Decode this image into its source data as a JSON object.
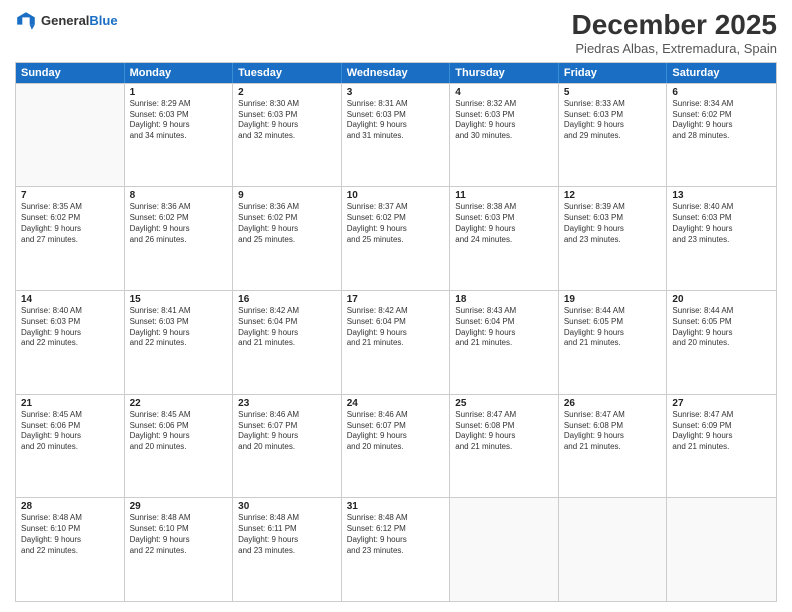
{
  "header": {
    "logo_general": "General",
    "logo_blue": "Blue",
    "title": "December 2025",
    "subtitle": "Piedras Albas, Extremadura, Spain"
  },
  "days_of_week": [
    "Sunday",
    "Monday",
    "Tuesday",
    "Wednesday",
    "Thursday",
    "Friday",
    "Saturday"
  ],
  "weeks": [
    [
      {
        "day": "",
        "lines": []
      },
      {
        "day": "1",
        "lines": [
          "Sunrise: 8:29 AM",
          "Sunset: 6:03 PM",
          "Daylight: 9 hours",
          "and 34 minutes."
        ]
      },
      {
        "day": "2",
        "lines": [
          "Sunrise: 8:30 AM",
          "Sunset: 6:03 PM",
          "Daylight: 9 hours",
          "and 32 minutes."
        ]
      },
      {
        "day": "3",
        "lines": [
          "Sunrise: 8:31 AM",
          "Sunset: 6:03 PM",
          "Daylight: 9 hours",
          "and 31 minutes."
        ]
      },
      {
        "day": "4",
        "lines": [
          "Sunrise: 8:32 AM",
          "Sunset: 6:03 PM",
          "Daylight: 9 hours",
          "and 30 minutes."
        ]
      },
      {
        "day": "5",
        "lines": [
          "Sunrise: 8:33 AM",
          "Sunset: 6:03 PM",
          "Daylight: 9 hours",
          "and 29 minutes."
        ]
      },
      {
        "day": "6",
        "lines": [
          "Sunrise: 8:34 AM",
          "Sunset: 6:02 PM",
          "Daylight: 9 hours",
          "and 28 minutes."
        ]
      }
    ],
    [
      {
        "day": "7",
        "lines": [
          "Sunrise: 8:35 AM",
          "Sunset: 6:02 PM",
          "Daylight: 9 hours",
          "and 27 minutes."
        ]
      },
      {
        "day": "8",
        "lines": [
          "Sunrise: 8:36 AM",
          "Sunset: 6:02 PM",
          "Daylight: 9 hours",
          "and 26 minutes."
        ]
      },
      {
        "day": "9",
        "lines": [
          "Sunrise: 8:36 AM",
          "Sunset: 6:02 PM",
          "Daylight: 9 hours",
          "and 25 minutes."
        ]
      },
      {
        "day": "10",
        "lines": [
          "Sunrise: 8:37 AM",
          "Sunset: 6:02 PM",
          "Daylight: 9 hours",
          "and 25 minutes."
        ]
      },
      {
        "day": "11",
        "lines": [
          "Sunrise: 8:38 AM",
          "Sunset: 6:03 PM",
          "Daylight: 9 hours",
          "and 24 minutes."
        ]
      },
      {
        "day": "12",
        "lines": [
          "Sunrise: 8:39 AM",
          "Sunset: 6:03 PM",
          "Daylight: 9 hours",
          "and 23 minutes."
        ]
      },
      {
        "day": "13",
        "lines": [
          "Sunrise: 8:40 AM",
          "Sunset: 6:03 PM",
          "Daylight: 9 hours",
          "and 23 minutes."
        ]
      }
    ],
    [
      {
        "day": "14",
        "lines": [
          "Sunrise: 8:40 AM",
          "Sunset: 6:03 PM",
          "Daylight: 9 hours",
          "and 22 minutes."
        ]
      },
      {
        "day": "15",
        "lines": [
          "Sunrise: 8:41 AM",
          "Sunset: 6:03 PM",
          "Daylight: 9 hours",
          "and 22 minutes."
        ]
      },
      {
        "day": "16",
        "lines": [
          "Sunrise: 8:42 AM",
          "Sunset: 6:04 PM",
          "Daylight: 9 hours",
          "and 21 minutes."
        ]
      },
      {
        "day": "17",
        "lines": [
          "Sunrise: 8:42 AM",
          "Sunset: 6:04 PM",
          "Daylight: 9 hours",
          "and 21 minutes."
        ]
      },
      {
        "day": "18",
        "lines": [
          "Sunrise: 8:43 AM",
          "Sunset: 6:04 PM",
          "Daylight: 9 hours",
          "and 21 minutes."
        ]
      },
      {
        "day": "19",
        "lines": [
          "Sunrise: 8:44 AM",
          "Sunset: 6:05 PM",
          "Daylight: 9 hours",
          "and 21 minutes."
        ]
      },
      {
        "day": "20",
        "lines": [
          "Sunrise: 8:44 AM",
          "Sunset: 6:05 PM",
          "Daylight: 9 hours",
          "and 20 minutes."
        ]
      }
    ],
    [
      {
        "day": "21",
        "lines": [
          "Sunrise: 8:45 AM",
          "Sunset: 6:06 PM",
          "Daylight: 9 hours",
          "and 20 minutes."
        ]
      },
      {
        "day": "22",
        "lines": [
          "Sunrise: 8:45 AM",
          "Sunset: 6:06 PM",
          "Daylight: 9 hours",
          "and 20 minutes."
        ]
      },
      {
        "day": "23",
        "lines": [
          "Sunrise: 8:46 AM",
          "Sunset: 6:07 PM",
          "Daylight: 9 hours",
          "and 20 minutes."
        ]
      },
      {
        "day": "24",
        "lines": [
          "Sunrise: 8:46 AM",
          "Sunset: 6:07 PM",
          "Daylight: 9 hours",
          "and 20 minutes."
        ]
      },
      {
        "day": "25",
        "lines": [
          "Sunrise: 8:47 AM",
          "Sunset: 6:08 PM",
          "Daylight: 9 hours",
          "and 21 minutes."
        ]
      },
      {
        "day": "26",
        "lines": [
          "Sunrise: 8:47 AM",
          "Sunset: 6:08 PM",
          "Daylight: 9 hours",
          "and 21 minutes."
        ]
      },
      {
        "day": "27",
        "lines": [
          "Sunrise: 8:47 AM",
          "Sunset: 6:09 PM",
          "Daylight: 9 hours",
          "and 21 minutes."
        ]
      }
    ],
    [
      {
        "day": "28",
        "lines": [
          "Sunrise: 8:48 AM",
          "Sunset: 6:10 PM",
          "Daylight: 9 hours",
          "and 22 minutes."
        ]
      },
      {
        "day": "29",
        "lines": [
          "Sunrise: 8:48 AM",
          "Sunset: 6:10 PM",
          "Daylight: 9 hours",
          "and 22 minutes."
        ]
      },
      {
        "day": "30",
        "lines": [
          "Sunrise: 8:48 AM",
          "Sunset: 6:11 PM",
          "Daylight: 9 hours",
          "and 23 minutes."
        ]
      },
      {
        "day": "31",
        "lines": [
          "Sunrise: 8:48 AM",
          "Sunset: 6:12 PM",
          "Daylight: 9 hours",
          "and 23 minutes."
        ]
      },
      {
        "day": "",
        "lines": []
      },
      {
        "day": "",
        "lines": []
      },
      {
        "day": "",
        "lines": []
      }
    ]
  ]
}
